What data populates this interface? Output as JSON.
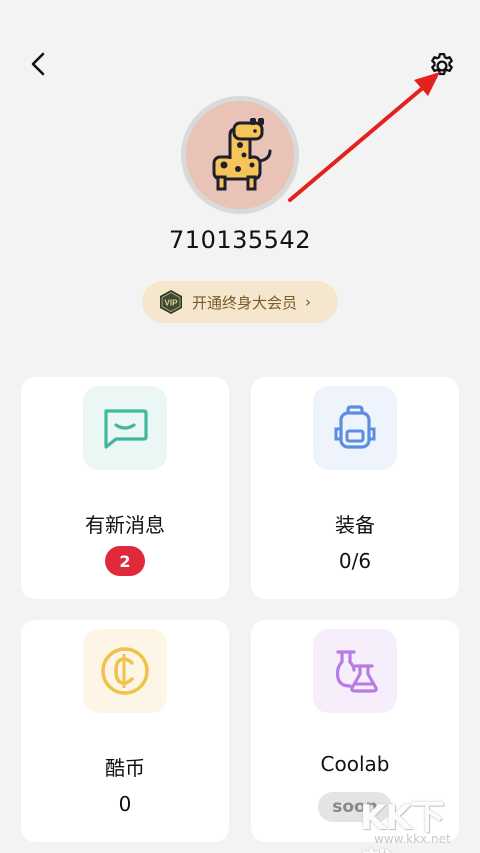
{
  "profile": {
    "username": "710135542"
  },
  "vip": {
    "badge_text": "VIP",
    "label": "开通终身大会员",
    "chevron": "›"
  },
  "cards": [
    {
      "title": "有新消息",
      "value": "2",
      "icon": "message-icon",
      "color": "#3fb89e",
      "bg": "#eaf7f4"
    },
    {
      "title": "装备",
      "value": "0/6",
      "icon": "backpack-icon",
      "color": "#5b8de3",
      "bg": "#eef3fc"
    },
    {
      "title": "酷币",
      "value": "0",
      "icon": "coin-icon",
      "color": "#f0c24b",
      "bg": "#fdf6e6"
    },
    {
      "title": "Coolab",
      "value": "soon",
      "icon": "flask-icon",
      "color": "#b77be4",
      "bg": "#f6eefb"
    }
  ],
  "watermark": {
    "main": "KK下载",
    "url": "www.kkx.net"
  },
  "colors": {
    "background": "#f3f3f3",
    "vip_bg": "#f4e7cd",
    "vip_text": "#7a5b29",
    "badge_red": "#e02a3c",
    "annotation_red": "#e3211f"
  }
}
